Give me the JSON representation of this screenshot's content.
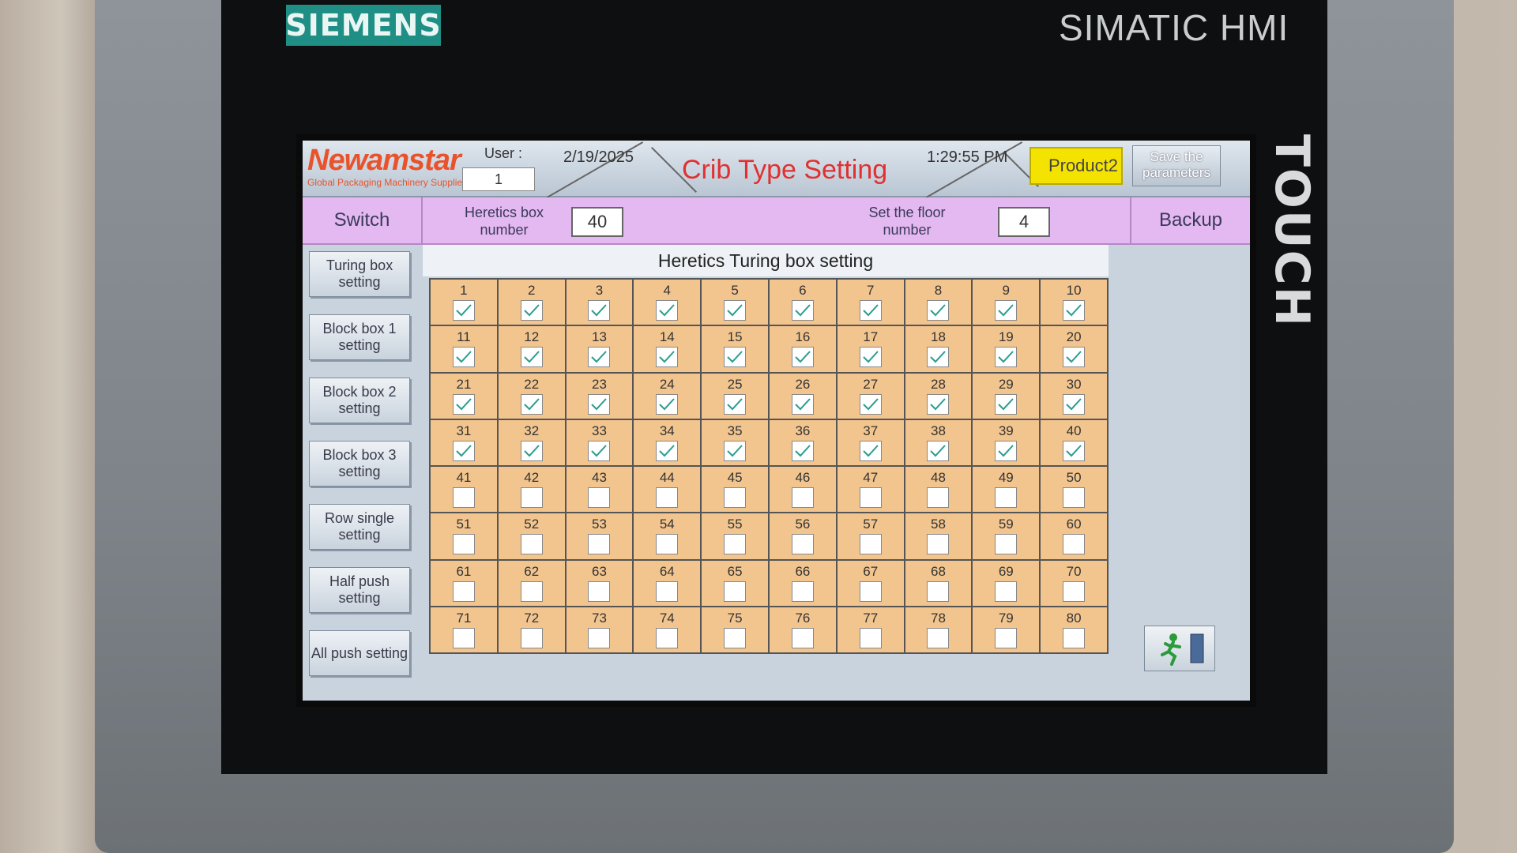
{
  "device": {
    "brand": "SIEMENS",
    "model": "SIMATIC HMI",
    "touch_label": "TOUCH"
  },
  "header": {
    "logo": "Newamstar",
    "logo_tagline": "Global Packaging Machinery Supplier",
    "user_label": "User :",
    "user_value": "1",
    "date": "2/19/2025",
    "title": "Crib Type Setting",
    "time": "1:29:55 PM",
    "product": "Product2",
    "save_label": "Save the parameters"
  },
  "toolbar": {
    "switch_label": "Switch",
    "heretics_box_label": "Heretics box number",
    "heretics_box_value": "40",
    "floor_label": "Set the floor number",
    "floor_value": "4",
    "backup_label": "Backup"
  },
  "menu": [
    {
      "label": "Turing box setting"
    },
    {
      "label": "Block box 1 setting"
    },
    {
      "label": "Block box 2 setting"
    },
    {
      "label": "Block box 3 setting"
    },
    {
      "label": "Row single setting"
    },
    {
      "label": "Half push setting"
    },
    {
      "label": "All push setting"
    }
  ],
  "section_title": "Heretics Turing box setting",
  "boxes": [
    {
      "n": "1",
      "checked": true
    },
    {
      "n": "2",
      "checked": true
    },
    {
      "n": "3",
      "checked": true
    },
    {
      "n": "4",
      "checked": true
    },
    {
      "n": "5",
      "checked": true
    },
    {
      "n": "6",
      "checked": true
    },
    {
      "n": "7",
      "checked": true
    },
    {
      "n": "8",
      "checked": true
    },
    {
      "n": "9",
      "checked": true
    },
    {
      "n": "10",
      "checked": true
    },
    {
      "n": "11",
      "checked": true
    },
    {
      "n": "12",
      "checked": true
    },
    {
      "n": "13",
      "checked": true
    },
    {
      "n": "14",
      "checked": true
    },
    {
      "n": "15",
      "checked": true
    },
    {
      "n": "16",
      "checked": true
    },
    {
      "n": "17",
      "checked": true
    },
    {
      "n": "18",
      "checked": true
    },
    {
      "n": "19",
      "checked": true
    },
    {
      "n": "20",
      "checked": true
    },
    {
      "n": "21",
      "checked": true
    },
    {
      "n": "22",
      "checked": true
    },
    {
      "n": "23",
      "checked": true
    },
    {
      "n": "24",
      "checked": true
    },
    {
      "n": "25",
      "checked": true
    },
    {
      "n": "26",
      "checked": true
    },
    {
      "n": "27",
      "checked": true
    },
    {
      "n": "28",
      "checked": true
    },
    {
      "n": "29",
      "checked": true
    },
    {
      "n": "30",
      "checked": true
    },
    {
      "n": "31",
      "checked": true
    },
    {
      "n": "32",
      "checked": true
    },
    {
      "n": "33",
      "checked": true
    },
    {
      "n": "34",
      "checked": true
    },
    {
      "n": "35",
      "checked": true
    },
    {
      "n": "36",
      "checked": true
    },
    {
      "n": "37",
      "checked": true
    },
    {
      "n": "38",
      "checked": true
    },
    {
      "n": "39",
      "checked": true
    },
    {
      "n": "40",
      "checked": true
    },
    {
      "n": "41",
      "checked": false
    },
    {
      "n": "42",
      "checked": false
    },
    {
      "n": "43",
      "checked": false
    },
    {
      "n": "44",
      "checked": false
    },
    {
      "n": "45",
      "checked": false
    },
    {
      "n": "46",
      "checked": false
    },
    {
      "n": "47",
      "checked": false
    },
    {
      "n": "48",
      "checked": false
    },
    {
      "n": "49",
      "checked": false
    },
    {
      "n": "50",
      "checked": false
    },
    {
      "n": "51",
      "checked": false
    },
    {
      "n": "52",
      "checked": false
    },
    {
      "n": "53",
      "checked": false
    },
    {
      "n": "54",
      "checked": false
    },
    {
      "n": "55",
      "checked": false
    },
    {
      "n": "56",
      "checked": false
    },
    {
      "n": "57",
      "checked": false
    },
    {
      "n": "58",
      "checked": false
    },
    {
      "n": "59",
      "checked": false
    },
    {
      "n": "60",
      "checked": false
    },
    {
      "n": "61",
      "checked": false
    },
    {
      "n": "62",
      "checked": false
    },
    {
      "n": "63",
      "checked": false
    },
    {
      "n": "64",
      "checked": false
    },
    {
      "n": "65",
      "checked": false
    },
    {
      "n": "66",
      "checked": false
    },
    {
      "n": "67",
      "checked": false
    },
    {
      "n": "68",
      "checked": false
    },
    {
      "n": "69",
      "checked": false
    },
    {
      "n": "70",
      "checked": false
    },
    {
      "n": "71",
      "checked": false
    },
    {
      "n": "72",
      "checked": false
    },
    {
      "n": "73",
      "checked": false
    },
    {
      "n": "74",
      "checked": false
    },
    {
      "n": "75",
      "checked": false
    },
    {
      "n": "76",
      "checked": false
    },
    {
      "n": "77",
      "checked": false
    },
    {
      "n": "78",
      "checked": false
    },
    {
      "n": "79",
      "checked": false
    },
    {
      "n": "80",
      "checked": false
    }
  ],
  "colors": {
    "cell_bg": "#f2c58f",
    "toolbar_bg": "#e4b8f0",
    "product_bg": "#f4e300",
    "title_color": "#e03030",
    "check_color": "#2a9d8f"
  },
  "exit_icon": "exit-icon"
}
